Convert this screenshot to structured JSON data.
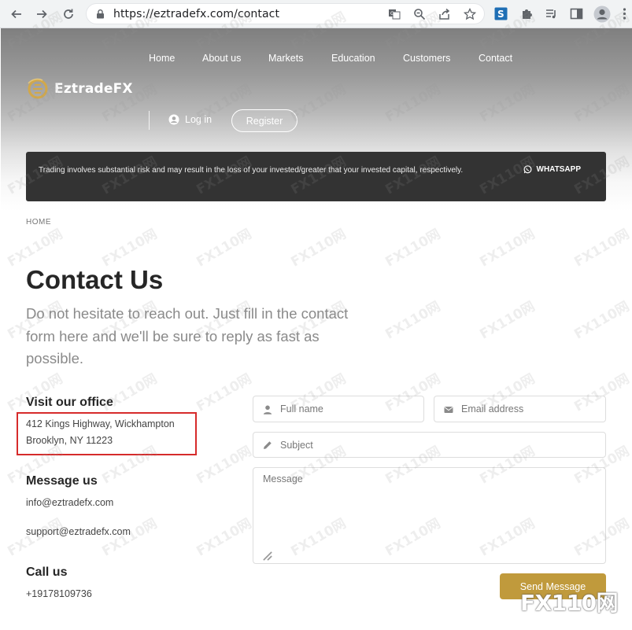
{
  "browser": {
    "url": "https://eztradefx.com/contact",
    "icons": [
      "back-icon",
      "forward-icon",
      "reload-icon",
      "lock-icon",
      "translate-icon",
      "zoom-icon",
      "share-icon",
      "bookmark-star-icon",
      "extension-s-icon",
      "puzzle-extension-icon",
      "media-control-icon",
      "side-panel-icon",
      "profile-icon",
      "more-menu-icon"
    ]
  },
  "nav": {
    "items": [
      "Home",
      "About us",
      "Markets",
      "Education",
      "Customers",
      "Contact"
    ]
  },
  "logo": {
    "text": "EztradeFX"
  },
  "auth": {
    "login": "Log in",
    "register": "Register"
  },
  "risk_banner": {
    "text": "Trading involves substantial risk and may result in the loss of your invested/greater that your invested capital, respectively.",
    "whatsapp": "WHATSAPP"
  },
  "breadcrumb": "HOME",
  "contact": {
    "title": "Contact Us",
    "intro": "Do not hesitate to reach out. Just fill in the contact form here and we'll be sure to reply as fast as possible.",
    "office_heading": "Visit our office",
    "address_line1": "412 Kings Highway, Wickhampton",
    "address_line2": "Brooklyn, NY 11223",
    "message_heading": "Message us",
    "email_info": "info@eztradefx.com",
    "email_support": "support@eztradefx.com",
    "call_heading": "Call us",
    "phone": "+19178109736"
  },
  "form": {
    "full_name": "Full name",
    "email": "Email address",
    "subject": "Subject",
    "message": "Message",
    "send": "Send Message"
  },
  "watermark": {
    "text": "FX110网",
    "corner": "FX110网"
  },
  "colors": {
    "accent": "#c09a3c",
    "banner": "#333333",
    "highlight": "#d62b2b"
  }
}
